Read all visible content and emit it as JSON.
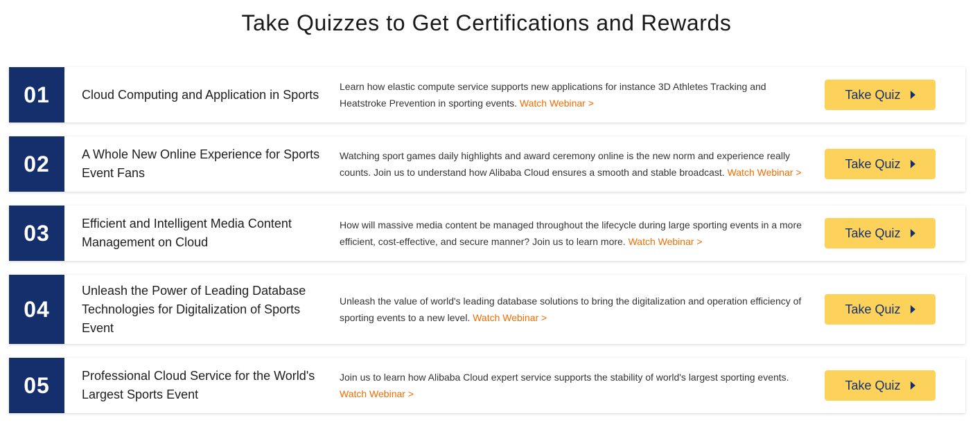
{
  "page": {
    "title": "Take Quizzes to Get Certifications and Rewards"
  },
  "colors": {
    "number_box": "#142f6c",
    "button": "#fcd25b",
    "button_text": "#142f6c",
    "link": "#f36c00"
  },
  "quizzes": [
    {
      "number": "01",
      "title": "Cloud Computing and Application in Sports",
      "description": "Learn how elastic compute service supports new applications for instance 3D Athletes Tracking and Heatstroke Prevention in sporting events.",
      "link_label": "Watch Webinar >",
      "button_label": "Take Quiz",
      "icon": "caret-right-icon"
    },
    {
      "number": "02",
      "title": "A Whole New Online Experience for Sports Event Fans",
      "description": "Watching sport games daily highlights and award ceremony online is the new norm and experience really counts. Join us to understand how Alibaba Cloud ensures a smooth and stable broadcast.",
      "link_label": "Watch Webinar >",
      "button_label": "Take Quiz",
      "icon": "caret-right-icon"
    },
    {
      "number": "03",
      "title": "Efficient and Intelligent Media Content Management on Cloud",
      "description": "How will massive media content be managed throughout the lifecycle during large sporting events in a more efficient, cost-effective, and secure manner? Join us to learn more.",
      "link_label": "Watch Webinar >",
      "button_label": "Take Quiz",
      "icon": "caret-right-icon"
    },
    {
      "number": "04",
      "title": "Unleash the Power of Leading Database Technologies for Digitalization of Sports Event",
      "description": "Unleash the value of world's leading database solutions to bring the digitalization and operation efficiency of sporting events to a new level.",
      "link_label": "Watch Webinar >",
      "button_label": "Take Quiz",
      "icon": "caret-right-icon"
    },
    {
      "number": "05",
      "title": "Professional Cloud Service for the World's Largest Sports Event",
      "description": "Join us to learn how Alibaba Cloud expert service supports the stability of world's largest sporting events.",
      "link_label": "Watch Webinar >",
      "button_label": "Take Quiz",
      "icon": "caret-right-icon"
    }
  ]
}
